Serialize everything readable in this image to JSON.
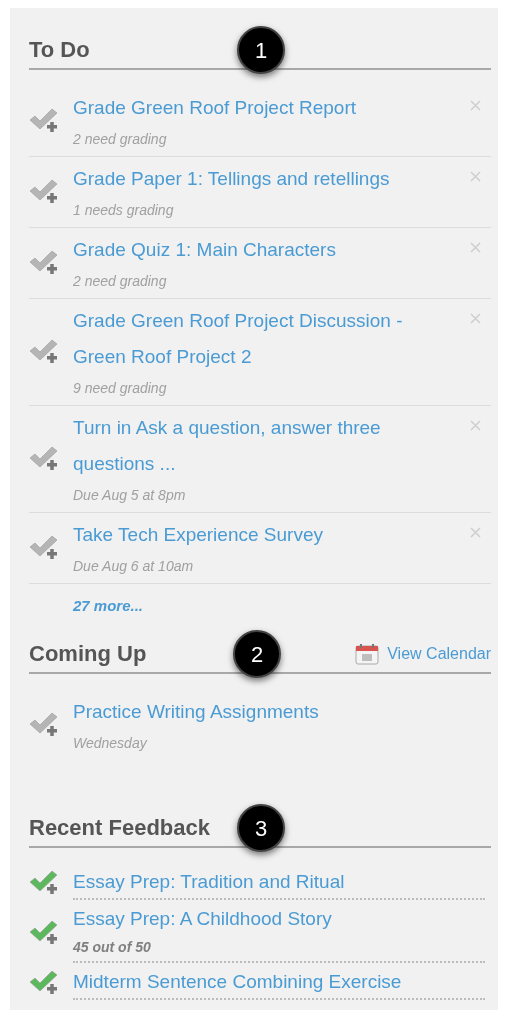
{
  "sections": [
    {
      "kind": "todo",
      "title": "To Do",
      "callout": "1",
      "items": [
        {
          "kind": "pending",
          "title": "Grade Green Roof Project Report",
          "detail": "2 need grading",
          "dismissable": true
        },
        {
          "kind": "pending",
          "title": "Grade Paper 1: Tellings and retellings",
          "detail": "1 needs grading",
          "dismissable": true
        },
        {
          "kind": "pending",
          "title": "Grade Quiz 1: Main Characters",
          "detail": "2 need grading",
          "dismissable": true
        },
        {
          "kind": "pending",
          "title": "Grade Green Roof Project Discussion - Green Roof Project 2",
          "detail": "9 need grading",
          "dismissable": true
        },
        {
          "kind": "pending",
          "title": "Turn in Ask a question, answer three questions ...",
          "detail": "Due Aug 5 at 8pm",
          "dismissable": true
        },
        {
          "kind": "pending",
          "title": "Take Tech Experience Survey",
          "detail": "Due Aug 6 at 10am",
          "dismissable": true
        }
      ],
      "more": "27 more..."
    },
    {
      "kind": "upcoming",
      "title": "Coming Up",
      "callout": "2",
      "link": "View Calendar",
      "items": [
        {
          "kind": "pending",
          "title": "Practice Writing Assignments",
          "detail": "Wednesday",
          "dismissable": false
        }
      ]
    },
    {
      "kind": "feedback",
      "title": "Recent Feedback",
      "callout": "3",
      "items": [
        {
          "kind": "graded",
          "title": "Essay Prep: Tradition and Ritual",
          "dismissable": false
        },
        {
          "kind": "graded",
          "title": "Essay Prep: A Childhood Story",
          "detail": "45 out of 50",
          "dismissable": false
        },
        {
          "kind": "graded",
          "title": "Midterm Sentence Combining Exercise",
          "dismissable": false
        }
      ]
    }
  ]
}
